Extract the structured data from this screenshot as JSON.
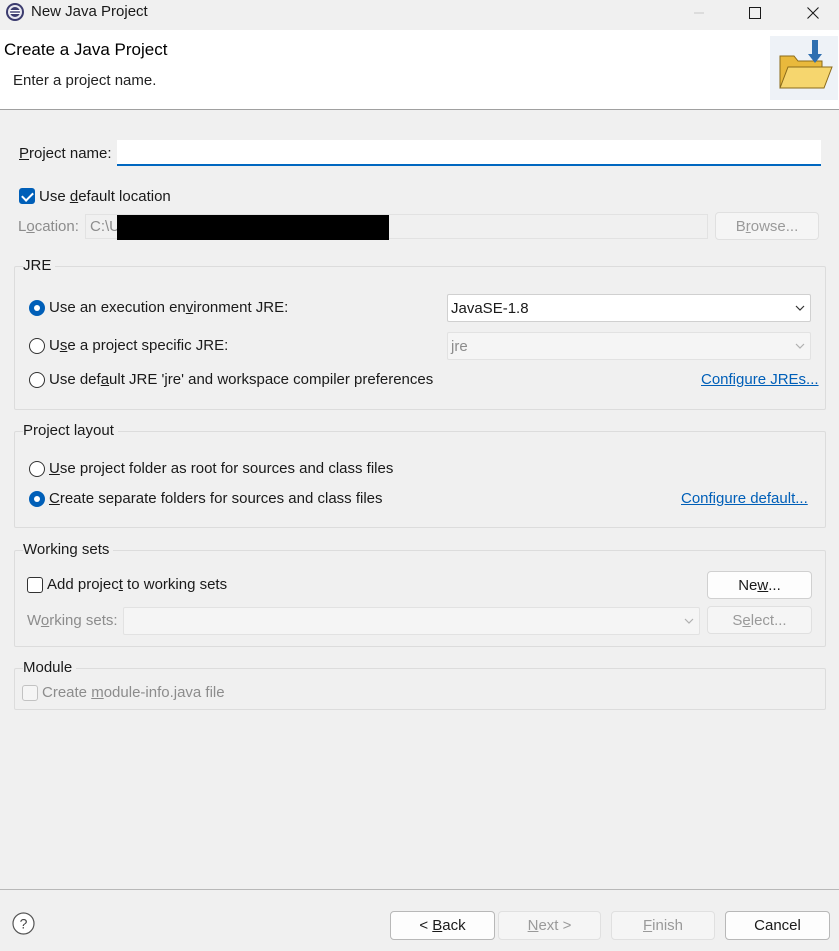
{
  "window": {
    "title": "New Java Project",
    "icon": "eclipse-gear-icon"
  },
  "header": {
    "title": "Create a Java Project",
    "subtitle": "Enter a project name.",
    "icon": "new-folder-wizard-icon"
  },
  "project_name": {
    "label_pre": "",
    "label_u": "P",
    "label_post": "roject name:",
    "value": ""
  },
  "location": {
    "use_default_pre": "Use ",
    "use_default_u": "d",
    "use_default_post": "efault location",
    "use_default_checked": true,
    "label_pre": "L",
    "label_u": "o",
    "label_post": "cation:",
    "value": "C:\\U",
    "browse_pre": "B",
    "browse_u": "r",
    "browse_post": "owse..."
  },
  "jre": {
    "title": "JRE",
    "options": [
      {
        "pre": "Use an execution en",
        "u": "v",
        "post": "ironment JRE:",
        "selected": true
      },
      {
        "pre": "U",
        "u": "s",
        "post": "e a project specific JRE:",
        "selected": false
      },
      {
        "pre": "Use def",
        "u": "a",
        "post": "ult JRE 'jre' and workspace compiler preferences",
        "selected": false
      }
    ],
    "exec_env_value": "JavaSE-1.8",
    "specific_value": "jre",
    "configure_link": "Configure JREs..."
  },
  "layout": {
    "title": "Project layout",
    "options": [
      {
        "pre": "",
        "u": "U",
        "post": "se project folder as root for sources and class files",
        "selected": false
      },
      {
        "pre": "",
        "u": "C",
        "post": "reate separate folders for sources and class files",
        "selected": true
      }
    ],
    "configure_link": "Configure default..."
  },
  "working_sets": {
    "title": "Working sets",
    "add_pre": "Add projec",
    "add_u": "t",
    "add_post": " to working sets",
    "add_checked": false,
    "new_pre": "Ne",
    "new_u": "w",
    "new_post": "...",
    "label_pre": "W",
    "label_u": "o",
    "label_post": "rking sets:",
    "select_pre": "S",
    "select_u": "e",
    "select_post": "lect..."
  },
  "module": {
    "title": "Module",
    "create_pre": "Create ",
    "create_u": "m",
    "create_post": "odule-info.java file",
    "checked": false
  },
  "footer": {
    "help_icon": "help-icon",
    "back_pre": "< ",
    "back_u": "B",
    "back_post": "ack",
    "next_pre": "",
    "next_u": "N",
    "next_post": "ext >",
    "finish_pre": "",
    "finish_u": "F",
    "finish_post": "inish",
    "cancel": "Cancel"
  },
  "colors": {
    "accent": "#005fb8",
    "link": "#005fb8",
    "background": "#f0f0f0"
  }
}
